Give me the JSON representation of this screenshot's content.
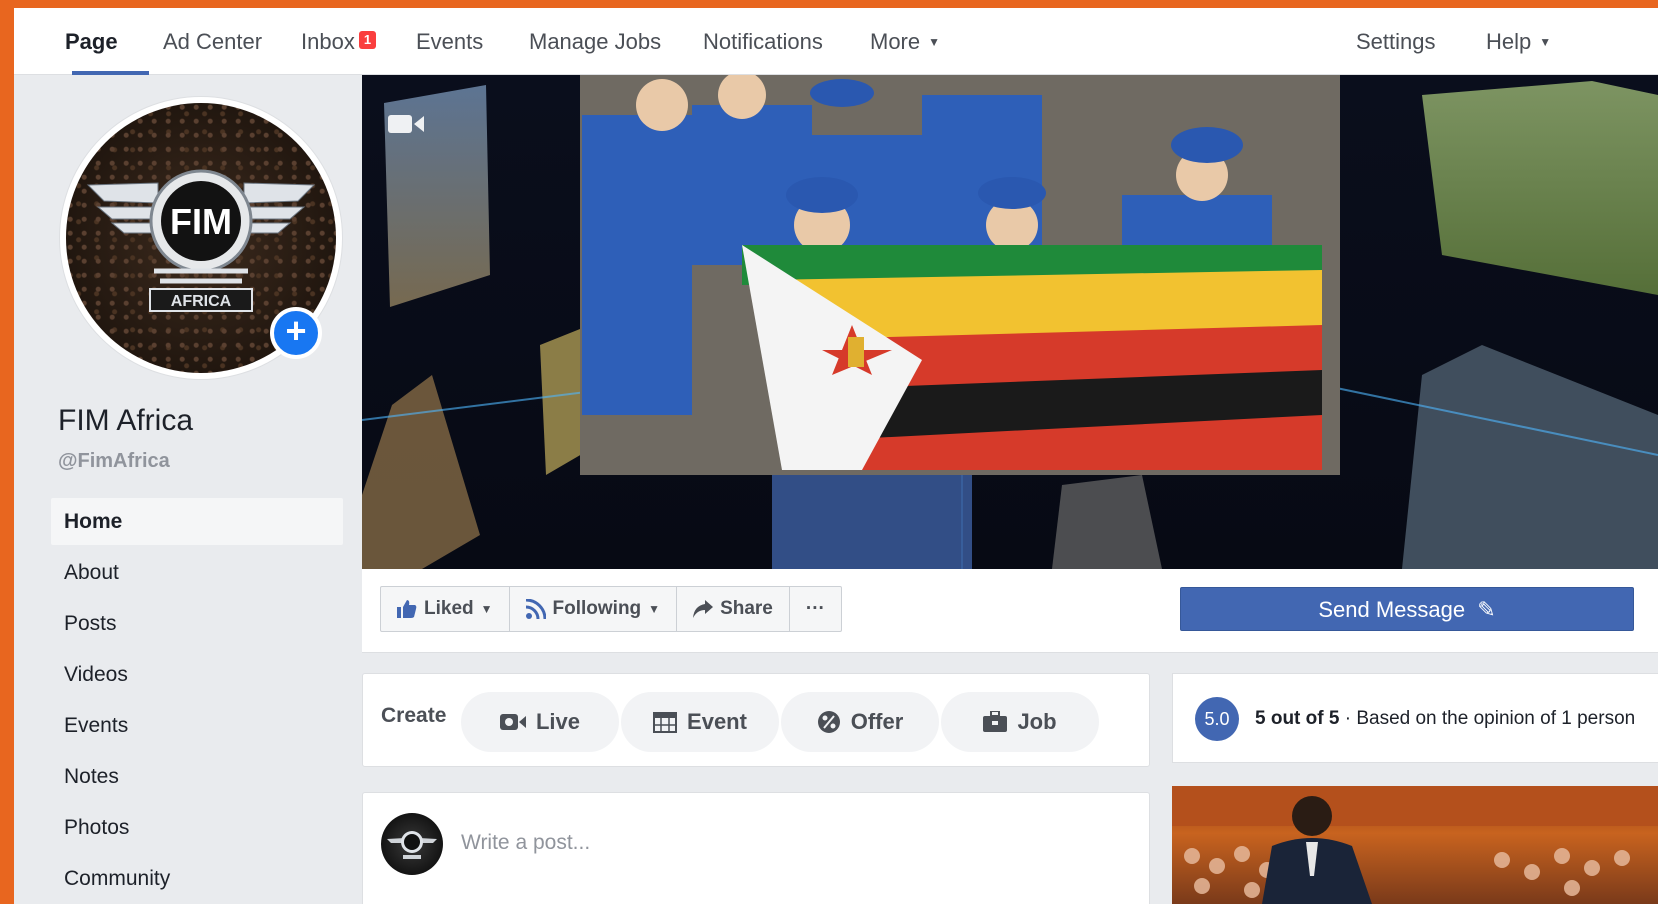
{
  "nav": {
    "items": [
      "Page",
      "Ad Center",
      "Inbox",
      "Events",
      "Manage Jobs",
      "Notifications",
      "More"
    ],
    "inbox_badge": "1",
    "settings": "Settings",
    "help": "Help"
  },
  "profile": {
    "name": "FIM Africa",
    "handle": "@FimAfrica",
    "logo_text": "FIM",
    "logo_sub": "AFRICA"
  },
  "sidebar": {
    "items": [
      {
        "label": "Home",
        "active": true
      },
      {
        "label": "About"
      },
      {
        "label": "Posts"
      },
      {
        "label": "Videos"
      },
      {
        "label": "Events"
      },
      {
        "label": "Notes"
      },
      {
        "label": "Photos"
      },
      {
        "label": "Community"
      }
    ]
  },
  "actions": {
    "liked": "Liked",
    "following": "Following",
    "share": "Share",
    "more": "···",
    "send_message": "Send Message"
  },
  "create": {
    "label": "Create",
    "live": "Live",
    "event": "Event",
    "offer": "Offer",
    "job": "Job"
  },
  "post": {
    "placeholder": "Write a post..."
  },
  "rating": {
    "score": "5.0",
    "summary": "5 out of 5",
    "detail": " · Based on the opinion of 1 person"
  },
  "colors": {
    "brand_blue": "#4267b2",
    "frame_orange": "#e8661f",
    "badge_red": "#fa3e3e"
  }
}
